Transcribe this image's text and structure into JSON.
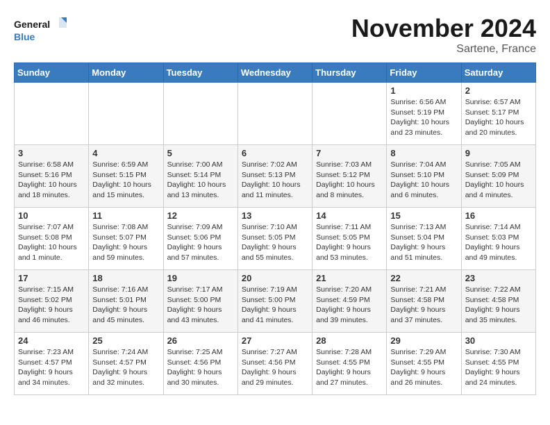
{
  "header": {
    "logo_line1": "General",
    "logo_line2": "Blue",
    "month": "November 2024",
    "location": "Sartene, France"
  },
  "weekdays": [
    "Sunday",
    "Monday",
    "Tuesday",
    "Wednesday",
    "Thursday",
    "Friday",
    "Saturday"
  ],
  "weeks": [
    [
      {
        "day": "",
        "info": ""
      },
      {
        "day": "",
        "info": ""
      },
      {
        "day": "",
        "info": ""
      },
      {
        "day": "",
        "info": ""
      },
      {
        "day": "",
        "info": ""
      },
      {
        "day": "1",
        "info": "Sunrise: 6:56 AM\nSunset: 5:19 PM\nDaylight: 10 hours\nand 23 minutes."
      },
      {
        "day": "2",
        "info": "Sunrise: 6:57 AM\nSunset: 5:17 PM\nDaylight: 10 hours\nand 20 minutes."
      }
    ],
    [
      {
        "day": "3",
        "info": "Sunrise: 6:58 AM\nSunset: 5:16 PM\nDaylight: 10 hours\nand 18 minutes."
      },
      {
        "day": "4",
        "info": "Sunrise: 6:59 AM\nSunset: 5:15 PM\nDaylight: 10 hours\nand 15 minutes."
      },
      {
        "day": "5",
        "info": "Sunrise: 7:00 AM\nSunset: 5:14 PM\nDaylight: 10 hours\nand 13 minutes."
      },
      {
        "day": "6",
        "info": "Sunrise: 7:02 AM\nSunset: 5:13 PM\nDaylight: 10 hours\nand 11 minutes."
      },
      {
        "day": "7",
        "info": "Sunrise: 7:03 AM\nSunset: 5:12 PM\nDaylight: 10 hours\nand 8 minutes."
      },
      {
        "day": "8",
        "info": "Sunrise: 7:04 AM\nSunset: 5:10 PM\nDaylight: 10 hours\nand 6 minutes."
      },
      {
        "day": "9",
        "info": "Sunrise: 7:05 AM\nSunset: 5:09 PM\nDaylight: 10 hours\nand 4 minutes."
      }
    ],
    [
      {
        "day": "10",
        "info": "Sunrise: 7:07 AM\nSunset: 5:08 PM\nDaylight: 10 hours\nand 1 minute."
      },
      {
        "day": "11",
        "info": "Sunrise: 7:08 AM\nSunset: 5:07 PM\nDaylight: 9 hours\nand 59 minutes."
      },
      {
        "day": "12",
        "info": "Sunrise: 7:09 AM\nSunset: 5:06 PM\nDaylight: 9 hours\nand 57 minutes."
      },
      {
        "day": "13",
        "info": "Sunrise: 7:10 AM\nSunset: 5:05 PM\nDaylight: 9 hours\nand 55 minutes."
      },
      {
        "day": "14",
        "info": "Sunrise: 7:11 AM\nSunset: 5:05 PM\nDaylight: 9 hours\nand 53 minutes."
      },
      {
        "day": "15",
        "info": "Sunrise: 7:13 AM\nSunset: 5:04 PM\nDaylight: 9 hours\nand 51 minutes."
      },
      {
        "day": "16",
        "info": "Sunrise: 7:14 AM\nSunset: 5:03 PM\nDaylight: 9 hours\nand 49 minutes."
      }
    ],
    [
      {
        "day": "17",
        "info": "Sunrise: 7:15 AM\nSunset: 5:02 PM\nDaylight: 9 hours\nand 46 minutes."
      },
      {
        "day": "18",
        "info": "Sunrise: 7:16 AM\nSunset: 5:01 PM\nDaylight: 9 hours\nand 45 minutes."
      },
      {
        "day": "19",
        "info": "Sunrise: 7:17 AM\nSunset: 5:00 PM\nDaylight: 9 hours\nand 43 minutes."
      },
      {
        "day": "20",
        "info": "Sunrise: 7:19 AM\nSunset: 5:00 PM\nDaylight: 9 hours\nand 41 minutes."
      },
      {
        "day": "21",
        "info": "Sunrise: 7:20 AM\nSunset: 4:59 PM\nDaylight: 9 hours\nand 39 minutes."
      },
      {
        "day": "22",
        "info": "Sunrise: 7:21 AM\nSunset: 4:58 PM\nDaylight: 9 hours\nand 37 minutes."
      },
      {
        "day": "23",
        "info": "Sunrise: 7:22 AM\nSunset: 4:58 PM\nDaylight: 9 hours\nand 35 minutes."
      }
    ],
    [
      {
        "day": "24",
        "info": "Sunrise: 7:23 AM\nSunset: 4:57 PM\nDaylight: 9 hours\nand 34 minutes."
      },
      {
        "day": "25",
        "info": "Sunrise: 7:24 AM\nSunset: 4:57 PM\nDaylight: 9 hours\nand 32 minutes."
      },
      {
        "day": "26",
        "info": "Sunrise: 7:25 AM\nSunset: 4:56 PM\nDaylight: 9 hours\nand 30 minutes."
      },
      {
        "day": "27",
        "info": "Sunrise: 7:27 AM\nSunset: 4:56 PM\nDaylight: 9 hours\nand 29 minutes."
      },
      {
        "day": "28",
        "info": "Sunrise: 7:28 AM\nSunset: 4:55 PM\nDaylight: 9 hours\nand 27 minutes."
      },
      {
        "day": "29",
        "info": "Sunrise: 7:29 AM\nSunset: 4:55 PM\nDaylight: 9 hours\nand 26 minutes."
      },
      {
        "day": "30",
        "info": "Sunrise: 7:30 AM\nSunset: 4:55 PM\nDaylight: 9 hours\nand 24 minutes."
      }
    ]
  ]
}
